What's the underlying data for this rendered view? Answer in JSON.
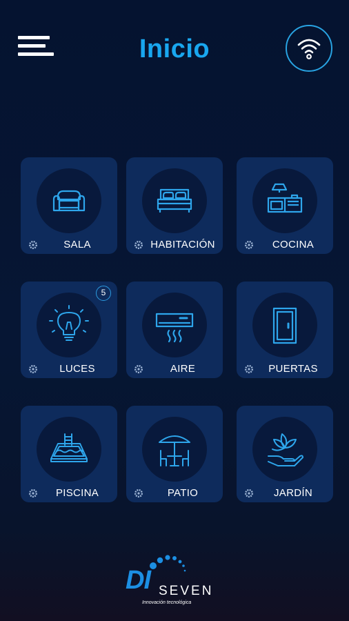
{
  "header": {
    "title": "Inicio",
    "menu_icon": "hamburger-menu-icon",
    "wifi_icon": "wifi-icon"
  },
  "rooms": [
    {
      "label": "SALA",
      "icon": "sofa-icon"
    },
    {
      "label": "HABITACIÓN",
      "icon": "bed-icon"
    },
    {
      "label": "COCINA",
      "icon": "kitchen-icon"
    },
    {
      "label": "LUCES",
      "icon": "light-bulb-icon",
      "badge": "5"
    },
    {
      "label": "AIRE",
      "icon": "air-conditioner-icon"
    },
    {
      "label": "PUERTAS",
      "icon": "door-icon"
    },
    {
      "label": "PISCINA",
      "icon": "pool-icon"
    },
    {
      "label": "PATIO",
      "icon": "patio-umbrella-icon"
    },
    {
      "label": "JARDÍN",
      "icon": "garden-plant-icon"
    }
  ],
  "brand": {
    "letters": "DI",
    "name": "SEVEN",
    "tagline": "Innovación tecnológica"
  },
  "colors": {
    "accent": "#19a7ef",
    "tile": "#0e2b5c",
    "icon_stroke": "#2ea6ec",
    "background": "#061634"
  }
}
